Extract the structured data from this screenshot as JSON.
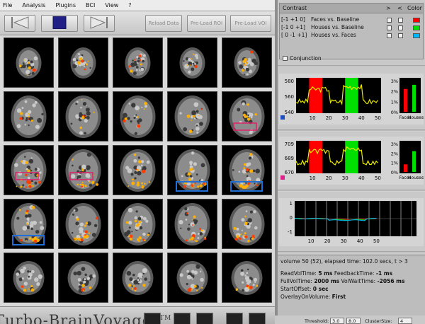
{
  "menu": [
    "File",
    "Analysis",
    "Plugins",
    "BCI",
    "View",
    "?"
  ],
  "toolbar": {
    "reload_label": "Reload Data",
    "preload_roi_label": "Pre-Load ROI",
    "preload_voi_label": "Pre-Load VOI",
    "icons": [
      "skip-to-start-icon",
      "stop-icon",
      "skip-to-end-icon"
    ]
  },
  "contrast_panel": {
    "header": "Contrast",
    "col_gt": ">",
    "col_lt": "<",
    "col_color": "Color",
    "rows": [
      {
        "weights": "[-1 +1 0]",
        "label": "Faces  vs. Baseline",
        "color": "#ff0000"
      },
      {
        "weights": "[-1  0 +1]",
        "label": "Houses vs. Baseline",
        "color": "#00e000"
      },
      {
        "weights": "[ 0 -1 +1]",
        "label": "Houses vs. Faces",
        "color": "#00b7ff"
      }
    ],
    "conjunction_label": "Conjunction"
  },
  "roi_plots": [
    {
      "y_ticks": [
        "580",
        "560",
        "540"
      ],
      "x_ticks": [
        "10",
        "20",
        "30",
        "40",
        "50"
      ],
      "bar_ticks": [
        "3%",
        "2%",
        "1%",
        "0%"
      ],
      "bar_labels": [
        "Faces",
        "Houses"
      ],
      "bar_values": [
        2.2,
        2.6
      ],
      "marker_color": "#2050c0"
    },
    {
      "y_ticks": [
        "709",
        "689",
        "670"
      ],
      "x_ticks": [
        "10",
        "20",
        "30",
        "40",
        "50"
      ],
      "bar_ticks": [
        "3%",
        "2%",
        "1%",
        "0%"
      ],
      "bar_labels": [
        "Faces",
        "Houses"
      ],
      "bar_values": [
        0.8,
        2.2
      ],
      "marker_color": "#e0208a"
    }
  ],
  "design_plot": {
    "y_ticks": [
      "1",
      "0",
      "-1"
    ],
    "x_ticks": [
      "10",
      "20",
      "30",
      "40",
      "50"
    ]
  },
  "status": {
    "volume_line": "volume 50 (52), elapsed time: 102.0 secs, t > 3",
    "readvoltime_label": "ReadVolTime:",
    "readvoltime_value": "5 ms",
    "feedbacktime_label": "FeedbackTime:",
    "feedbacktime_value": "-1 ms",
    "fullvoltime_label": "FullVolTime:",
    "fullvoltime_value": "2000 ms",
    "volwaittime_label": "VolWaitTime:",
    "volwaittime_value": "-2056 ms",
    "startoffset_label": "StartOffset:",
    "startoffset_value": "0 sec",
    "overlay_label": "OverlayOnVolume:",
    "overlay_value": "First"
  },
  "threshold_bar": {
    "threshold_label": "Threshold:",
    "threshold_min": "3.0",
    "threshold_max": "8.0",
    "clustersize_label": "ClusterSize:",
    "clustersize_value": "4"
  },
  "brand": {
    "name": "Turbo-BrainVoyager",
    "tm": "TM"
  },
  "colors": {
    "faces": "#ff0000",
    "houses": "#00e000",
    "houses_vs_faces": "#00b7ff",
    "roi_box_red": "#e0206a",
    "roi_box_blue": "#1f6fd6",
    "activation": "#ffb000",
    "timecourse": "#e8e800"
  }
}
